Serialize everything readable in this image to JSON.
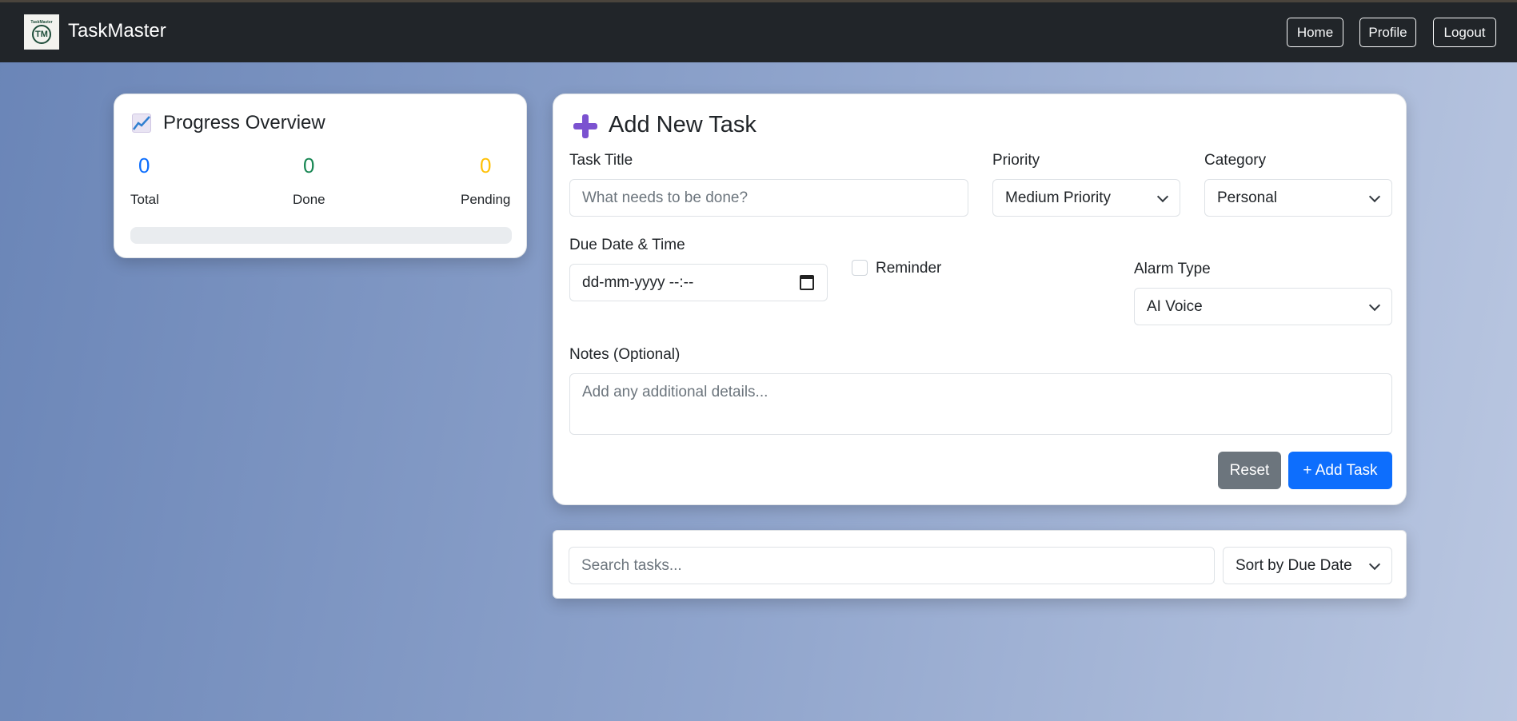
{
  "app": {
    "brand": "TaskMaster",
    "logo_text": "TaskMaster",
    "logo_mark": "TM"
  },
  "nav": {
    "home": "Home",
    "profile": "Profile",
    "logout": "Logout"
  },
  "progress": {
    "title": "Progress Overview",
    "icon": "chart-increasing-icon",
    "total": "0",
    "done": "0",
    "pending": "0",
    "total_label": "Total",
    "done_label": "Done",
    "pending_label": "Pending",
    "percent": 0,
    "colors": {
      "total": "#0d6efd",
      "done": "#198754",
      "pending": "#ffc107"
    }
  },
  "form": {
    "title": "Add New Task",
    "icon": "plus-icon",
    "task_title_label": "Task Title",
    "task_title_placeholder": "What needs to be done?",
    "priority_label": "Priority",
    "priority_value": "Medium Priority",
    "category_label": "Category",
    "category_value": "Personal",
    "due_label": "Due Date & Time",
    "due_value": "dd-mm-yyyy --:--",
    "reminder_label": "Reminder",
    "alarm_label": "Alarm Type",
    "alarm_value": "AI Voice",
    "notes_label": "Notes (Optional)",
    "notes_placeholder": "Add any additional details...",
    "reset": "Reset",
    "add": "+ Add Task"
  },
  "search": {
    "placeholder": "Search tasks...",
    "sort_value": "Sort by Due Date"
  }
}
